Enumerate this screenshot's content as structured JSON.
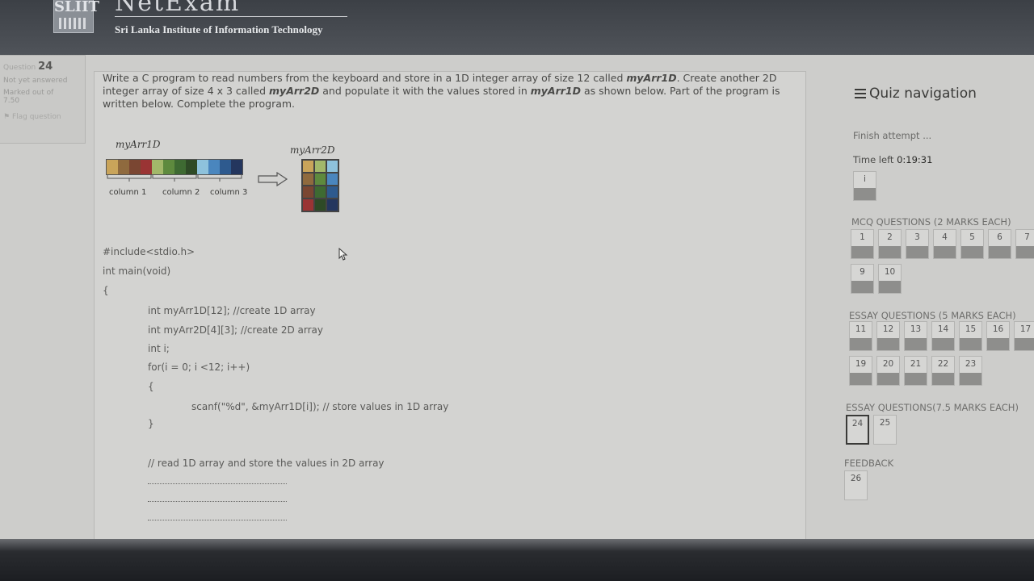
{
  "header": {
    "brand_title": "NetExam",
    "logo_text": "SLIIT",
    "institute": "Sri Lanka Institute of Information Technology"
  },
  "question_info": {
    "question_label": "Question",
    "question_number": "24",
    "status": "Not yet answered",
    "marked": "Marked out of",
    "marks": "7.50",
    "flag": "Flag question"
  },
  "question": {
    "line1_pre": "Write a C program to read numbers from the keyboard and store in  a 1D integer array of size 12 called ",
    "arr1": "myArr1D",
    "line1_mid": ". Create another 2D integer array of size 4 x 3 called ",
    "arr2": "myArr2D",
    "line1_post": " and populate it with the values stored in ",
    "arr1b": "myArr1D",
    "line1_end": " as shown below. Part of the program is written below. Complete the program.",
    "figure": {
      "label_1d": "myArr1D",
      "label_2d": "myArr2D",
      "col1": "column 1",
      "col2": "column 2",
      "col3": "column 3",
      "colors_1d": [
        "#c9a45a",
        "#8f6a3e",
        "#7a4632",
        "#9a3434",
        "#a2b86a",
        "#5e8a3e",
        "#3e6a32",
        "#2e4a26",
        "#8ec2dc",
        "#4a86be",
        "#2e5a8e",
        "#24365e"
      ],
      "colors_2d": [
        "#c9a45a",
        "#a2b86a",
        "#8ec2dc",
        "#8f6a3e",
        "#5e8a3e",
        "#4a86be",
        "#7a4632",
        "#3e6a32",
        "#2e5a8e",
        "#9a3434",
        "#2e4a26",
        "#24365e"
      ]
    },
    "code": {
      "l1": "#include<stdio.h>",
      "l2": "int main(void)",
      "l3": "{",
      "l4": "int myArr1D[12]; //create 1D array",
      "l5": "int myArr2D[4][3]; //create 2D array",
      "l6": "int i;",
      "l7": "for(i = 0; i <12; i++)",
      "l8": "{",
      "l9": "scanf(\"%d\", &myArr1D[i]);  // store values in 1D array",
      "l10": "}",
      "l11": "// read 1D array and store the values in 2D array"
    }
  },
  "nav": {
    "title": "Quiz navigation",
    "finish": "Finish attempt ...",
    "time_label": "Time left",
    "time": "0:19:31",
    "info_btn": "i",
    "mcq_title": "MCQ QUESTIONS (2 MARKS EACH)",
    "mcq_buttons": [
      "1",
      "2",
      "3",
      "4",
      "5",
      "6",
      "7",
      "9",
      "10"
    ],
    "essay5_title": "ESSAY QUESTIONS (5 MARKS EACH)",
    "essay5_buttons": [
      "11",
      "12",
      "13",
      "14",
      "15",
      "16",
      "17",
      "19",
      "20",
      "21",
      "22",
      "23"
    ],
    "essay75_title": "ESSAY QUESTIONS(7.5 MARKS EACH)",
    "essay75_buttons": [
      "24",
      "25"
    ],
    "feedback_title": "FEEDBACK",
    "feedback_buttons": [
      "26"
    ]
  }
}
